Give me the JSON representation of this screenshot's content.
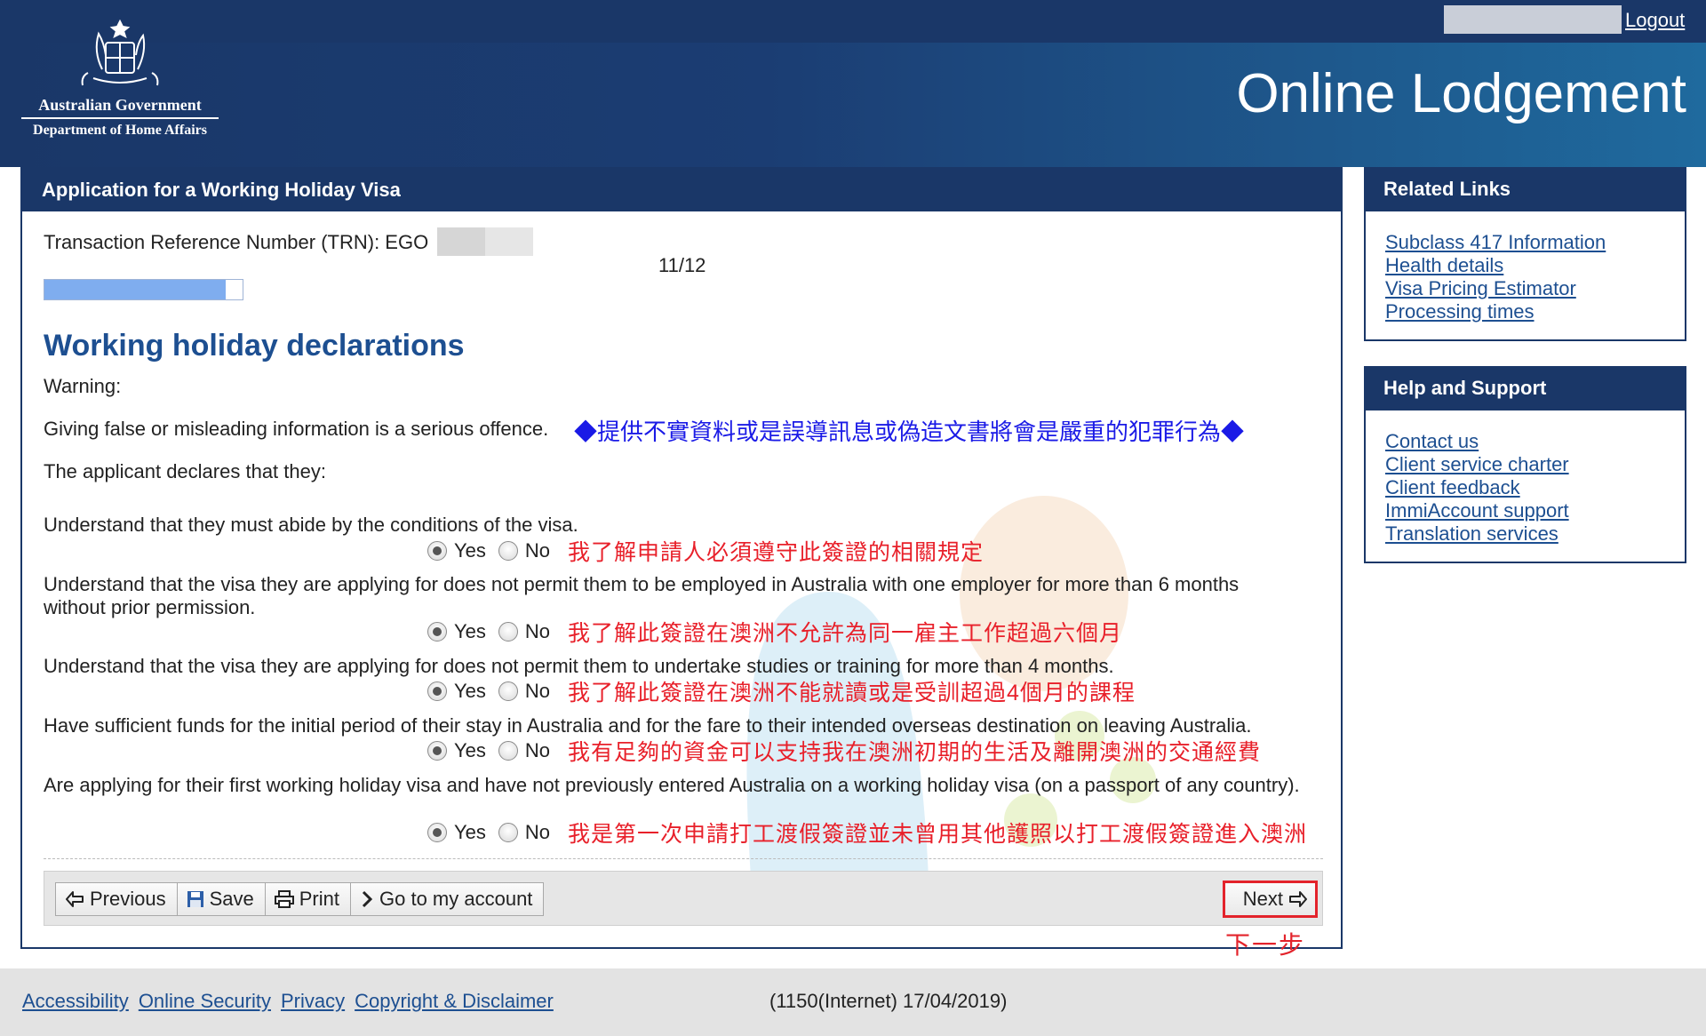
{
  "header": {
    "app_title": "Online Lodgement",
    "logout": "Logout",
    "logo_line1": "Australian Government",
    "logo_line2": "Department of Home Affairs"
  },
  "main": {
    "panel_title": "Application for a Working Holiday Visa",
    "trn_label": "Transaction Reference Number (TRN): EGO",
    "page_count": "11/12",
    "progress_fraction": 0.917,
    "section_title": "Working holiday declarations",
    "warning_label": "Warning:",
    "warning_text": "Giving false or misleading information is a serious offence.",
    "warning_translation": "◆提供不實資料或是誤導訊息或偽造文書將會是嚴重的犯罪行為◆",
    "declares_text": "The applicant declares that they:",
    "yes_label": "Yes",
    "no_label": "No",
    "questions": [
      {
        "text": "Understand that they must abide by the conditions of the visa.",
        "translation": "我了解申請人必須遵守此簽證的相關規定",
        "selected": "Yes"
      },
      {
        "text": "Understand that the visa they are applying for does not permit them to be employed in Australia with one employer for more than 6 months without prior permission.",
        "translation": "我了解此簽證在澳洲不允許為同一雇主工作超過六個月",
        "selected": "Yes"
      },
      {
        "text": "Understand that the visa they are applying for does not permit them to undertake studies or training for more than 4 months.",
        "translation": "我了解此簽證在澳洲不能就讀或是受訓超過4個月的課程",
        "selected": "Yes"
      },
      {
        "text": "Have sufficient funds for the initial period of their stay in Australia and for the fare to their intended overseas destination on leaving Australia.",
        "translation": "我有足夠的資金可以支持我在澳洲初期的生活及離開澳洲的交通經費",
        "selected": "Yes"
      },
      {
        "text": "Are applying for their first working holiday visa and have not previously entered Australia on a working holiday visa (on a passport of any country).",
        "translation": "我是第一次申請打工渡假簽證並未曾用其他護照以打工渡假簽證進入澳洲",
        "selected": "Yes"
      }
    ],
    "buttons": {
      "previous": "Previous",
      "save": "Save",
      "print": "Print",
      "account": "Go to my account",
      "next": "Next",
      "next_translation": "下一步"
    }
  },
  "sidebar": {
    "related": {
      "title": "Related Links",
      "links": [
        "Subclass 417 Information",
        "Health details",
        "Visa Pricing Estimator",
        "Processing times"
      ]
    },
    "help": {
      "title": "Help and Support",
      "links": [
        "Contact us",
        "Client service charter",
        "Client feedback",
        "ImmiAccount support",
        "Translation services"
      ]
    }
  },
  "footer": {
    "links": [
      "Accessibility",
      "Online Security",
      "Privacy",
      "Copyright & Disclaimer"
    ],
    "version": "(1150(Internet) 17/04/2019)"
  },
  "colors": {
    "navy": "#1a3768",
    "link": "#1d4f91",
    "translation_red": "#e8202a",
    "translation_blue": "#1a1ae6",
    "progress": "#7fadef"
  },
  "icons": [
    "crest-icon",
    "previous-arrow-icon",
    "save-disk-icon",
    "printer-icon",
    "chevron-right-icon",
    "next-arrow-icon"
  ]
}
